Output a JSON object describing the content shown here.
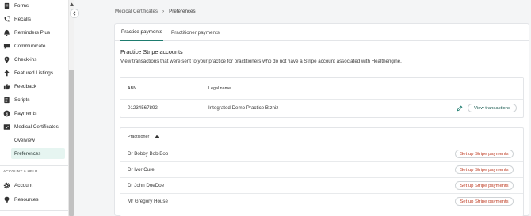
{
  "sidebar": {
    "items": [
      {
        "label": "Forms",
        "icon": "forms-icon"
      },
      {
        "label": "Recalls",
        "icon": "phone-recall-icon"
      },
      {
        "label": "Reminders Plus",
        "icon": "bell-icon"
      },
      {
        "label": "Communicate",
        "icon": "chat-icon"
      },
      {
        "label": "Check-ins",
        "icon": "location-pin-icon"
      },
      {
        "label": "Featured Listings",
        "icon": "featured-arrow-icon"
      },
      {
        "label": "Feedback",
        "icon": "thumbs-up-icon"
      },
      {
        "label": "Scripts",
        "icon": "script-icon"
      },
      {
        "label": "Payments",
        "icon": "dollar-icon"
      },
      {
        "label": "Medical Certificates",
        "icon": "certificate-icon"
      }
    ],
    "sub_items": [
      {
        "label": "Overview"
      },
      {
        "label": "Preferences"
      }
    ],
    "section_label": "ACCOUNT & HELP",
    "account_items": [
      {
        "label": "Account",
        "icon": "gear-icon"
      },
      {
        "label": "Resources",
        "icon": "lightbulb-icon"
      }
    ]
  },
  "breadcrumb": {
    "parent": "Medical Certificates",
    "separator": "›",
    "current": "Preferences"
  },
  "tabs": [
    {
      "label": "Practice payments",
      "active": true
    },
    {
      "label": "Practitioner payments",
      "active": false
    }
  ],
  "section": {
    "title": "Practice Stripe accounts",
    "description": "View transactions that were sent to your practice for practitioners who do not have a Stripe account associated with Healthengine."
  },
  "practice_table": {
    "headers": [
      "ABN",
      "Legal name"
    ],
    "row": {
      "abn": "01234567892",
      "legal_name": "Integrated Demo Practice Bizniz",
      "action": "View transactions"
    }
  },
  "practitioner_table": {
    "header": "Practitioner",
    "rows": [
      {
        "name": "Dr Bobby Bob Bob",
        "action": "Set up Stripe payments"
      },
      {
        "name": "Dr Ivor Cure",
        "action": "Set up Stripe payments"
      },
      {
        "name": "Dr John DoeDoe",
        "action": "Set up Stripe payments"
      },
      {
        "name": "Mr Gregory House",
        "action": "Set up Stripe payments"
      }
    ]
  },
  "colors": {
    "accent": "#1e7c6f",
    "active_bg": "#e6f5f1",
    "stripe_action": "#c1442c"
  }
}
